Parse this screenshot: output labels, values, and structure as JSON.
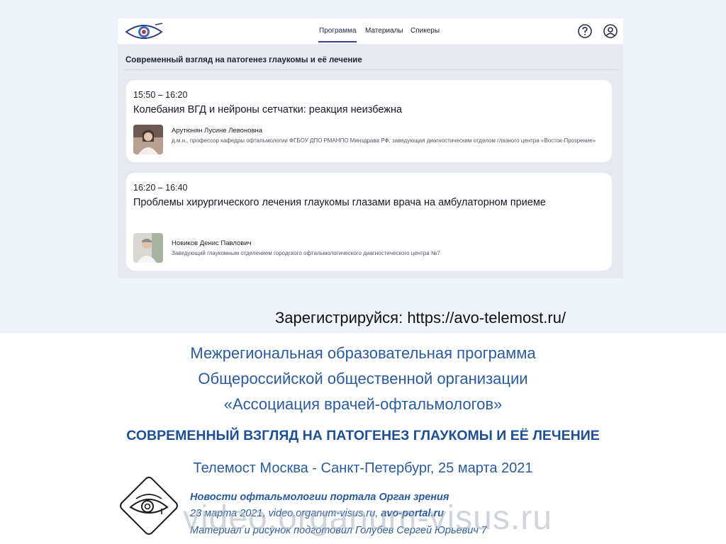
{
  "app": {
    "nav": {
      "tabs": [
        {
          "label": "Программа"
        },
        {
          "label": "Материалы"
        },
        {
          "label": "Спикеры"
        }
      ],
      "icons": [
        "eye-logo-icon",
        "help-icon",
        "user-icon"
      ]
    },
    "section_title": "Современный взгляд на патогенез глаукомы и её лечение",
    "sessions": [
      {
        "time": "15:50 – 16:20",
        "title": "Колебания ВГД и нейроны сетчатки: реакция неизбежна",
        "speaker_name": "Арутюнян Лусине Левоновна",
        "speaker_role": "д.м.н., профессор кафедры офтальмологии ФГБОУ ДПО РМАНПО Минздрава РФ, заведующая диагностическим отделом глазного центра «Восток-Прозрение»"
      },
      {
        "time": "16:20 – 16:40",
        "title": "Проблемы хирургического лечения глаукомы глазами врача на амбулаторном приеме",
        "speaker_name": "Новиков Денис Павлович",
        "speaker_role": "Заведующий глаукомным отделением городского офтальмологического диагностического центра №7"
      }
    ]
  },
  "register_text": "Зарегистрируйся: https://avo-telemost.ru/",
  "program": {
    "line1": "Межрегиональная образовательная программа",
    "line2": "Общероссийской общественной организации",
    "line3": "«Ассоциация врачей-офтальмологов»",
    "headline": "СОВРЕМЕННЫЙ ВЗГЛЯД НА ПАТОГЕНЕЗ ГЛАУКОМЫ И ЕЁ ЛЕЧЕНИЕ",
    "telemost": "Телемост Москва - Санкт-Петербург, 25 марта 2021"
  },
  "footer": {
    "line1": "Новости офтальмологии портала Орган зрения",
    "line2_prefix": "23 марта 2021, video.organum-visus.ru, ",
    "line2_bold": "avo-portal.ru",
    "line3": "Материал и рисунок подготовил Голубев Сергей Юрьевич  7",
    "watermark": "video.organum-visus.ru"
  },
  "colors": {
    "accent_blue": "#2a5b9e",
    "headline_blue": "#1c4f96",
    "nav_underline": "#3a3f8f"
  }
}
